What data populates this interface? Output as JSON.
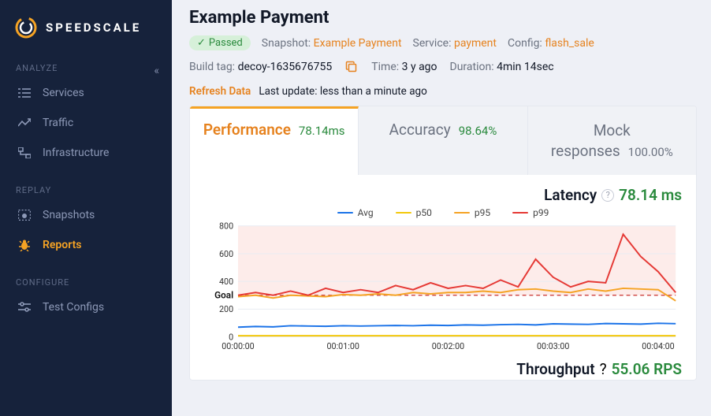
{
  "brand": "SPEEDSCALE",
  "sidebar": {
    "sections": {
      "analyze": {
        "label": "ANALYZE",
        "items": [
          {
            "label": "Services"
          },
          {
            "label": "Traffic"
          },
          {
            "label": "Infrastructure"
          }
        ]
      },
      "replay": {
        "label": "REPLAY",
        "items": [
          {
            "label": "Snapshots"
          },
          {
            "label": "Reports"
          }
        ]
      },
      "configure": {
        "label": "CONFIGURE",
        "items": [
          {
            "label": "Test Configs"
          }
        ]
      }
    }
  },
  "header": {
    "title": "Example Payment",
    "status": "Passed",
    "snapshot": {
      "key": "Snapshot:",
      "value": "Example Payment"
    },
    "service": {
      "key": "Service:",
      "value": "payment"
    },
    "config": {
      "key": "Config:",
      "value": "flash_sale"
    },
    "build_tag": {
      "key": "Build tag:",
      "value": "decoy-1635676755"
    },
    "time": {
      "key": "Time:",
      "value": "3 y ago"
    },
    "duration": {
      "key": "Duration:",
      "value": "4min 14sec"
    },
    "refresh_label": "Refresh Data",
    "refresh_text": "Last update: less than a minute ago"
  },
  "tabs": {
    "performance": {
      "label": "Performance",
      "metric": "78.14ms"
    },
    "accuracy": {
      "label": "Accuracy",
      "metric": "98.64%"
    },
    "mock": {
      "label1": "Mock",
      "label2": "responses",
      "metric": "100.00%"
    }
  },
  "latency": {
    "title": "Latency",
    "value": "78.14 ms",
    "legend": {
      "avg": "Avg",
      "p50": "p50",
      "p95": "p95",
      "p99": "p99"
    },
    "goal_label": "Goal"
  },
  "throughput": {
    "title": "Throughput",
    "value": "55.06 RPS"
  },
  "chart_data": {
    "type": "line",
    "title": "Latency",
    "xlabel": "",
    "ylabel": "",
    "ylim": [
      0,
      800
    ],
    "goal": 300,
    "yticks": [
      0,
      200,
      400,
      600,
      800
    ],
    "x": [
      "00:00:00",
      "00:00:10",
      "00:00:20",
      "00:00:30",
      "00:00:40",
      "00:00:50",
      "00:01:00",
      "00:01:10",
      "00:01:20",
      "00:01:30",
      "00:01:40",
      "00:01:50",
      "00:02:00",
      "00:02:10",
      "00:02:20",
      "00:02:30",
      "00:02:40",
      "00:02:50",
      "00:03:00",
      "00:03:10",
      "00:03:20",
      "00:03:30",
      "00:03:40",
      "00:03:50",
      "00:04:00",
      "00:04:10"
    ],
    "xticks": [
      "00:00:00",
      "00:01:00",
      "00:02:00",
      "00:03:00",
      "00:04:00"
    ],
    "series": [
      {
        "name": "Avg",
        "color": "#1b73e8",
        "values": [
          70,
          75,
          72,
          80,
          78,
          76,
          80,
          78,
          80,
          82,
          80,
          84,
          82,
          86,
          84,
          88,
          90,
          86,
          94,
          92,
          90,
          96,
          94,
          92,
          98,
          95
        ]
      },
      {
        "name": "p50",
        "color": "#f3c80b",
        "values": [
          8,
          8,
          8,
          8,
          8,
          8,
          8,
          8,
          8,
          8,
          8,
          8,
          8,
          8,
          8,
          8,
          8,
          8,
          8,
          8,
          8,
          8,
          8,
          8,
          8,
          8
        ]
      },
      {
        "name": "p95",
        "color": "#f5a324",
        "values": [
          290,
          300,
          280,
          300,
          295,
          290,
          305,
          300,
          310,
          300,
          320,
          310,
          320,
          320,
          330,
          320,
          340,
          345,
          330,
          320,
          345,
          330,
          350,
          345,
          340,
          260
        ]
      },
      {
        "name": "p99",
        "color": "#e53935",
        "values": [
          300,
          320,
          300,
          330,
          300,
          350,
          320,
          340,
          320,
          370,
          340,
          390,
          350,
          370,
          350,
          410,
          360,
          560,
          430,
          360,
          400,
          390,
          740,
          580,
          470,
          320
        ]
      }
    ],
    "legend_position": "top"
  }
}
